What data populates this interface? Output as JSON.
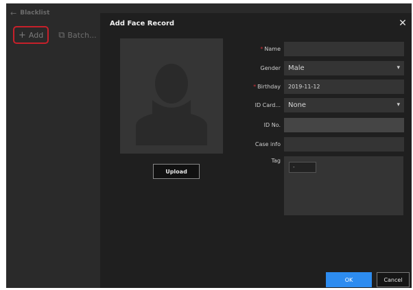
{
  "page": {
    "title": "Blacklist",
    "toolbar": {
      "add_label": "Add",
      "batch_label": "Batch..."
    }
  },
  "modal": {
    "title": "Add Face Record",
    "upload_label": "Upload",
    "fields": {
      "name_label": "Name",
      "name_value": "",
      "gender_label": "Gender",
      "gender_value": "Male",
      "birthday_label": "Birthday",
      "birthday_value": "2019-11-12",
      "idcard_label": "ID Card...",
      "idcard_value": "None",
      "idno_label": "ID No.",
      "idno_value": "",
      "caseinfo_label": "Case info",
      "caseinfo_value": "",
      "tag_label": "Tag",
      "tag_chip": "-"
    },
    "ok_label": "OK",
    "cancel_label": "Cancel"
  },
  "colors": {
    "accent": "#2d8cf0",
    "required": "#d0303a",
    "highlight": "#c8202a"
  }
}
